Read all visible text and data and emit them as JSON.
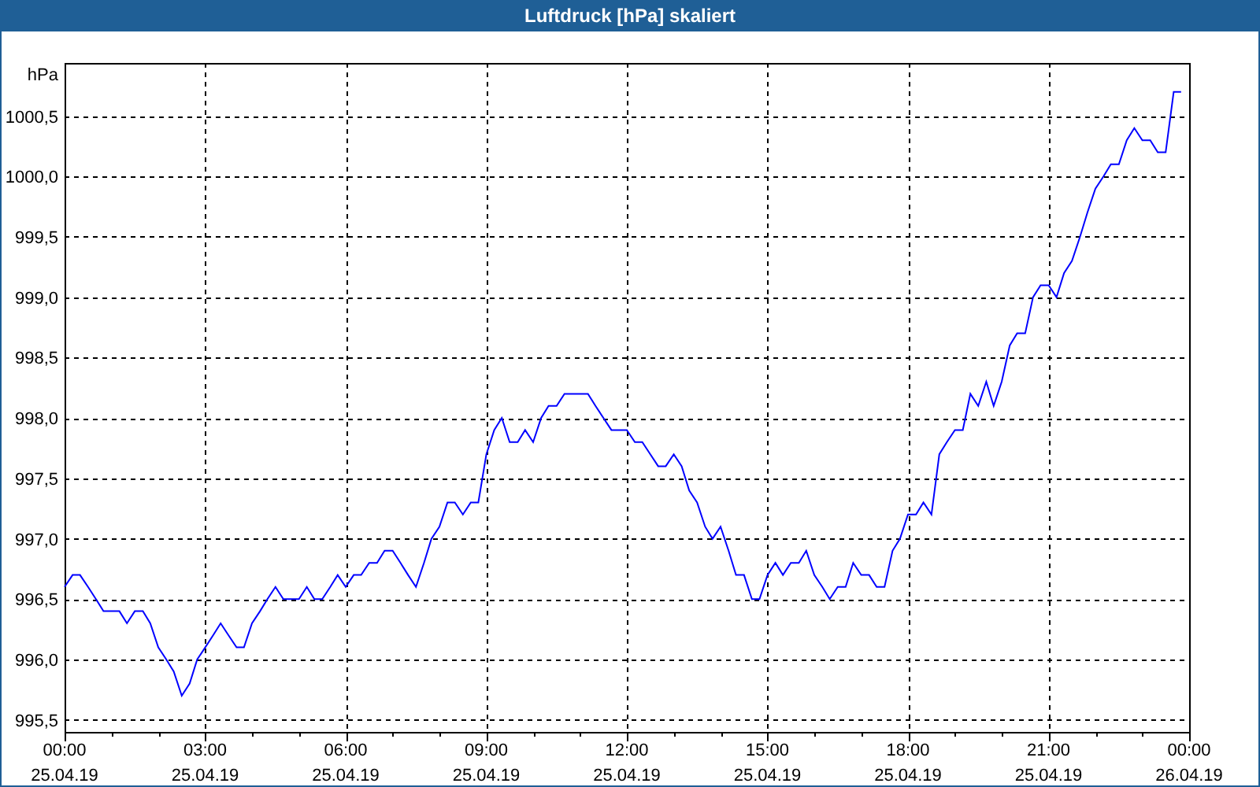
{
  "chart": {
    "x_dates": [
      "25.04.19",
      "25.04.19",
      "25.04.19",
      "25.04.19",
      "25.04.19",
      "25.04.19",
      "25.04.19",
      "25.04.19",
      "26.04.19"
    ],
    "chart_data": {
      "type": "line",
      "title": "Luftdruck [hPa] skaliert",
      "ylabel": "hPa",
      "grid": true,
      "xlim": [
        0,
        24
      ],
      "ylim": [
        995.4,
        1000.94
      ],
      "yticks": [
        {
          "value": 995.5,
          "label": "995,5"
        },
        {
          "value": 996,
          "label": "996,0"
        },
        {
          "value": 996.5,
          "label": "996,5"
        },
        {
          "value": 997,
          "label": "997,0"
        },
        {
          "value": 997.5,
          "label": "997,5"
        },
        {
          "value": 998,
          "label": "998,0"
        },
        {
          "value": 998.5,
          "label": "998,5"
        },
        {
          "value": 999,
          "label": "999,0"
        },
        {
          "value": 999.5,
          "label": "999,5"
        },
        {
          "value": 1000,
          "label": "1000,0"
        },
        {
          "value": 1000.5,
          "label": "1000,5"
        }
      ],
      "xticks": [
        {
          "value": 0,
          "label": "00:00"
        },
        {
          "value": 3,
          "label": "03:00"
        },
        {
          "value": 6,
          "label": "06:00"
        },
        {
          "value": 9,
          "label": "09:00"
        },
        {
          "value": 12,
          "label": "12:00"
        },
        {
          "value": 15,
          "label": "15:00"
        },
        {
          "value": 18,
          "label": "18:00"
        },
        {
          "value": 21,
          "label": "21:00"
        },
        {
          "value": 24,
          "label": "00:00"
        }
      ],
      "x": [
        0,
        0.17,
        0.33,
        0.5,
        0.67,
        0.83,
        1,
        1.17,
        1.33,
        1.5,
        1.67,
        1.83,
        2,
        2.17,
        2.33,
        2.5,
        2.67,
        2.83,
        3,
        3.17,
        3.33,
        3.5,
        3.67,
        3.83,
        4,
        4.17,
        4.33,
        4.5,
        4.67,
        4.83,
        5,
        5.17,
        5.33,
        5.5,
        5.67,
        5.83,
        6,
        6.17,
        6.33,
        6.5,
        6.67,
        6.83,
        7,
        7.17,
        7.33,
        7.5,
        7.67,
        7.83,
        8,
        8.17,
        8.33,
        8.5,
        8.67,
        8.83,
        9,
        9.17,
        9.33,
        9.5,
        9.67,
        9.83,
        10,
        10.17,
        10.33,
        10.5,
        10.67,
        10.83,
        11,
        11.17,
        11.33,
        11.5,
        11.67,
        11.83,
        12,
        12.17,
        12.33,
        12.5,
        12.67,
        12.83,
        13,
        13.17,
        13.33,
        13.5,
        13.67,
        13.83,
        14,
        14.17,
        14.33,
        14.5,
        14.67,
        14.83,
        15,
        15.17,
        15.33,
        15.5,
        15.67,
        15.83,
        16,
        16.17,
        16.33,
        16.5,
        16.67,
        16.83,
        17,
        17.17,
        17.33,
        17.5,
        17.67,
        17.83,
        18,
        18.17,
        18.33,
        18.5,
        18.67,
        18.83,
        19,
        19.17,
        19.33,
        19.5,
        19.67,
        19.83,
        20,
        20.17,
        20.33,
        20.5,
        20.67,
        20.83,
        21,
        21.17,
        21.33,
        21.5,
        21.67,
        21.83,
        22,
        22.17,
        22.33,
        22.5,
        22.67,
        22.83,
        23,
        23.17,
        23.33,
        23.5,
        23.67,
        23.83
      ],
      "series": [
        {
          "color": "#0000ff",
          "values": [
            996.6,
            996.7,
            996.7,
            996.6,
            996.5,
            996.4,
            996.4,
            996.4,
            996.3,
            996.4,
            996.4,
            996.3,
            996.1,
            996.0,
            995.9,
            995.7,
            995.8,
            996.0,
            996.1,
            996.2,
            996.3,
            996.2,
            996.1,
            996.1,
            996.3,
            996.4,
            996.5,
            996.6,
            996.5,
            996.5,
            996.5,
            996.6,
            996.5,
            996.5,
            996.6,
            996.7,
            996.6,
            996.7,
            996.7,
            996.8,
            996.8,
            996.9,
            996.9,
            996.8,
            996.7,
            996.6,
            996.8,
            997.0,
            997.1,
            997.3,
            997.3,
            997.2,
            997.3,
            997.3,
            997.7,
            997.9,
            998.0,
            997.8,
            997.8,
            997.9,
            997.8,
            998.0,
            998.1,
            998.1,
            998.2,
            998.2,
            998.2,
            998.2,
            998.1,
            998.0,
            997.9,
            997.9,
            997.9,
            997.8,
            997.8,
            997.7,
            997.6,
            997.6,
            997.7,
            997.6,
            997.4,
            997.3,
            997.1,
            997.0,
            997.1,
            996.9,
            996.7,
            996.7,
            996.5,
            996.5,
            996.7,
            996.8,
            996.7,
            996.8,
            996.8,
            996.9,
            996.7,
            996.6,
            996.5,
            996.6,
            996.6,
            996.8,
            996.7,
            996.7,
            996.6,
            996.6,
            996.9,
            997.0,
            997.2,
            997.2,
            997.3,
            997.2,
            997.7,
            997.8,
            997.9,
            997.9,
            998.2,
            998.1,
            998.3,
            998.1,
            998.3,
            998.6,
            998.7,
            998.7,
            999.0,
            999.1,
            999.1,
            999.0,
            999.2,
            999.3,
            999.5,
            999.7,
            999.9,
            1000.0,
            1000.1,
            1000.1,
            1000.3,
            1000.4,
            1000.3,
            1000.3,
            1000.2,
            1000.2,
            1000.7,
            1000.7
          ]
        }
      ]
    }
  }
}
